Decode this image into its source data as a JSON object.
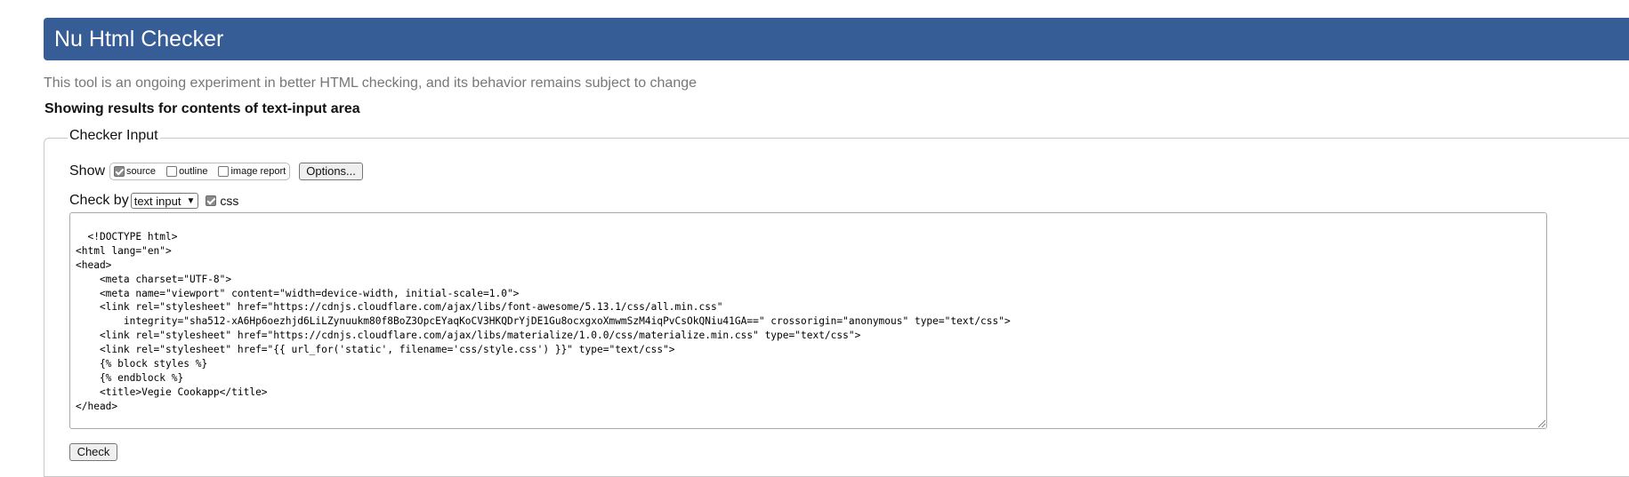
{
  "header": {
    "title": "Nu Html Checker"
  },
  "tagline": "This tool is an ongoing experiment in better HTML checking, and its behavior remains subject to change",
  "results_heading": "Showing results for contents of text-input area",
  "checker_input": {
    "legend": "Checker Input",
    "show": {
      "label": "Show",
      "options": [
        {
          "label": "source",
          "checked": true
        },
        {
          "label": "outline",
          "checked": false
        },
        {
          "label": "image report",
          "checked": false
        }
      ],
      "options_button": "Options..."
    },
    "check_by": {
      "label": "Check by",
      "selected": "text input",
      "css_label": "css",
      "css_checked": true
    },
    "source_text": "<!DOCTYPE html>\n<html lang=\"en\">\n<head>\n    <meta charset=\"UTF-8\">\n    <meta name=\"viewport\" content=\"width=device-width, initial-scale=1.0\">\n    <link rel=\"stylesheet\" href=\"https://cdnjs.cloudflare.com/ajax/libs/font-awesome/5.13.1/css/all.min.css\"\n        integrity=\"sha512-xA6Hp6oezhjd6LiLZynuukm80f8BoZ3OpcEYaqKoCV3HKQDrYjDE1Gu8ocxgxoXmwmSzM4iqPvCsOkQNiu41GA==\" crossorigin=\"anonymous\" type=\"text/css\">\n    <link rel=\"stylesheet\" href=\"https://cdnjs.cloudflare.com/ajax/libs/materialize/1.0.0/css/materialize.min.css\" type=\"text/css\">\n    <link rel=\"stylesheet\" href=\"{{ url_for('static', filename='css/style.css') }}\" type=\"text/css\">\n    {% block styles %}\n    {% endblock %}\n    <title>Vegie Cookapp</title>\n</head>",
    "check_button": "Check"
  },
  "colors": {
    "header_bg": "#365d95",
    "header_text": "#ffffff",
    "tagline": "#777777"
  }
}
